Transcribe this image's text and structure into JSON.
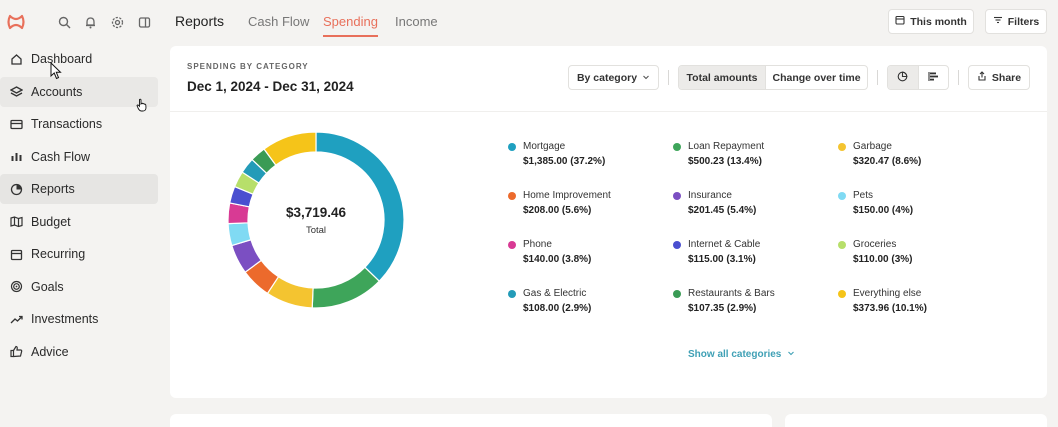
{
  "colors": {
    "accent": "#e8705b",
    "link": "#3fa0b5"
  },
  "sidebar": {
    "top_icons": [
      "logo-icon",
      "search-icon",
      "bell-icon",
      "gear-icon",
      "sidebar-toggle-icon"
    ],
    "items": [
      {
        "label": "Dashboard",
        "icon": "home-icon"
      },
      {
        "label": "Accounts",
        "icon": "layers-icon"
      },
      {
        "label": "Transactions",
        "icon": "credit-card-icon"
      },
      {
        "label": "Cash Flow",
        "icon": "bar-chart-icon"
      },
      {
        "label": "Reports",
        "icon": "pie-chart-icon"
      },
      {
        "label": "Budget",
        "icon": "map-icon"
      },
      {
        "label": "Recurring",
        "icon": "calendar-icon"
      },
      {
        "label": "Goals",
        "icon": "target-icon"
      },
      {
        "label": "Investments",
        "icon": "trend-icon"
      },
      {
        "label": "Advice",
        "icon": "thumbs-up-icon"
      }
    ],
    "active": "Reports"
  },
  "header": {
    "title": "Reports",
    "tabs": [
      {
        "label": "Cash Flow"
      },
      {
        "label": "Spending"
      },
      {
        "label": "Income"
      }
    ],
    "active_tab": "Spending",
    "date_button": "This month",
    "filters_button": "Filters"
  },
  "card": {
    "subtitle": "SPENDING BY CATEGORY",
    "title": "Dec 1, 2024 - Dec 31, 2024",
    "group_select": "By category",
    "segment": [
      "Total amounts",
      "Change over time"
    ],
    "segment_active": "Total amounts",
    "share_button": "Share",
    "show_all": "Show all categories"
  },
  "chart_data": {
    "type": "pie",
    "total_label": "$3,719.46",
    "total_caption": "Total",
    "slices": [
      {
        "name": "Mortgage",
        "value": 1385.0,
        "amount": "$1,385.00 (37.2%)",
        "color": "#1fa0c0"
      },
      {
        "name": "Loan Repayment",
        "value": 500.23,
        "amount": "$500.23 (13.4%)",
        "color": "#3ea55a"
      },
      {
        "name": "Garbage",
        "value": 320.47,
        "amount": "$320.47 (8.6%)",
        "color": "#f4c430"
      },
      {
        "name": "Home Improvement",
        "value": 208.0,
        "amount": "$208.00 (5.6%)",
        "color": "#ec6a2c"
      },
      {
        "name": "Insurance",
        "value": 201.45,
        "amount": "$201.45 (5.4%)",
        "color": "#7b4fc2"
      },
      {
        "name": "Pets",
        "value": 150.0,
        "amount": "$150.00 (4%)",
        "color": "#80daf3"
      },
      {
        "name": "Phone",
        "value": 140.0,
        "amount": "$140.00 (3.8%)",
        "color": "#d83a94"
      },
      {
        "name": "Internet & Cable",
        "value": 115.0,
        "amount": "$115.00 (3.1%)",
        "color": "#4a4fd0"
      },
      {
        "name": "Groceries",
        "value": 110.0,
        "amount": "$110.00 (3%)",
        "color": "#b7df6a"
      },
      {
        "name": "Gas & Electric",
        "value": 108.0,
        "amount": "$108.00 (2.9%)",
        "color": "#239bb8"
      },
      {
        "name": "Restaurants & Bars",
        "value": 107.35,
        "amount": "$107.35 (2.9%)",
        "color": "#3a9b55"
      },
      {
        "name": "Everything else",
        "value": 373.96,
        "amount": "$373.96 (10.1%)",
        "color": "#f5c419"
      }
    ]
  }
}
